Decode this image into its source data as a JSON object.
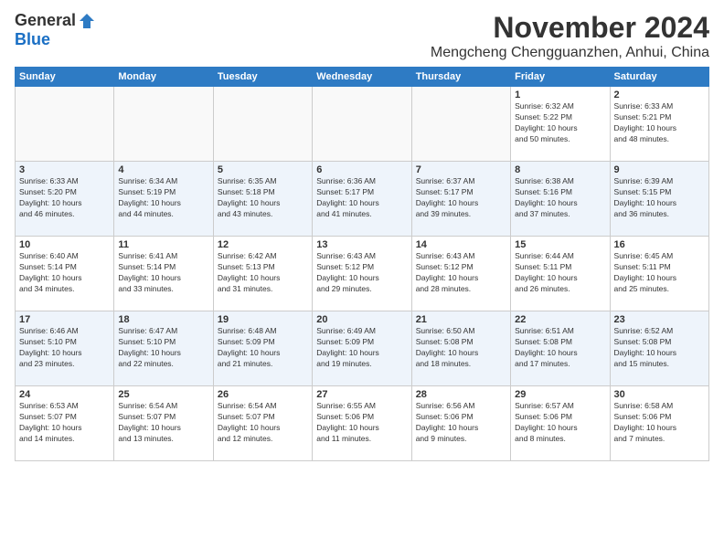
{
  "header": {
    "logo_general": "General",
    "logo_blue": "Blue",
    "month_title": "November 2024",
    "location": "Mengcheng Chengguanzhen, Anhui, China"
  },
  "weekdays": [
    "Sunday",
    "Monday",
    "Tuesday",
    "Wednesday",
    "Thursday",
    "Friday",
    "Saturday"
  ],
  "weeks": [
    [
      {
        "day": "",
        "info": ""
      },
      {
        "day": "",
        "info": ""
      },
      {
        "day": "",
        "info": ""
      },
      {
        "day": "",
        "info": ""
      },
      {
        "day": "",
        "info": ""
      },
      {
        "day": "1",
        "info": "Sunrise: 6:32 AM\nSunset: 5:22 PM\nDaylight: 10 hours\nand 50 minutes."
      },
      {
        "day": "2",
        "info": "Sunrise: 6:33 AM\nSunset: 5:21 PM\nDaylight: 10 hours\nand 48 minutes."
      }
    ],
    [
      {
        "day": "3",
        "info": "Sunrise: 6:33 AM\nSunset: 5:20 PM\nDaylight: 10 hours\nand 46 minutes."
      },
      {
        "day": "4",
        "info": "Sunrise: 6:34 AM\nSunset: 5:19 PM\nDaylight: 10 hours\nand 44 minutes."
      },
      {
        "day": "5",
        "info": "Sunrise: 6:35 AM\nSunset: 5:18 PM\nDaylight: 10 hours\nand 43 minutes."
      },
      {
        "day": "6",
        "info": "Sunrise: 6:36 AM\nSunset: 5:17 PM\nDaylight: 10 hours\nand 41 minutes."
      },
      {
        "day": "7",
        "info": "Sunrise: 6:37 AM\nSunset: 5:17 PM\nDaylight: 10 hours\nand 39 minutes."
      },
      {
        "day": "8",
        "info": "Sunrise: 6:38 AM\nSunset: 5:16 PM\nDaylight: 10 hours\nand 37 minutes."
      },
      {
        "day": "9",
        "info": "Sunrise: 6:39 AM\nSunset: 5:15 PM\nDaylight: 10 hours\nand 36 minutes."
      }
    ],
    [
      {
        "day": "10",
        "info": "Sunrise: 6:40 AM\nSunset: 5:14 PM\nDaylight: 10 hours\nand 34 minutes."
      },
      {
        "day": "11",
        "info": "Sunrise: 6:41 AM\nSunset: 5:14 PM\nDaylight: 10 hours\nand 33 minutes."
      },
      {
        "day": "12",
        "info": "Sunrise: 6:42 AM\nSunset: 5:13 PM\nDaylight: 10 hours\nand 31 minutes."
      },
      {
        "day": "13",
        "info": "Sunrise: 6:43 AM\nSunset: 5:12 PM\nDaylight: 10 hours\nand 29 minutes."
      },
      {
        "day": "14",
        "info": "Sunrise: 6:43 AM\nSunset: 5:12 PM\nDaylight: 10 hours\nand 28 minutes."
      },
      {
        "day": "15",
        "info": "Sunrise: 6:44 AM\nSunset: 5:11 PM\nDaylight: 10 hours\nand 26 minutes."
      },
      {
        "day": "16",
        "info": "Sunrise: 6:45 AM\nSunset: 5:11 PM\nDaylight: 10 hours\nand 25 minutes."
      }
    ],
    [
      {
        "day": "17",
        "info": "Sunrise: 6:46 AM\nSunset: 5:10 PM\nDaylight: 10 hours\nand 23 minutes."
      },
      {
        "day": "18",
        "info": "Sunrise: 6:47 AM\nSunset: 5:10 PM\nDaylight: 10 hours\nand 22 minutes."
      },
      {
        "day": "19",
        "info": "Sunrise: 6:48 AM\nSunset: 5:09 PM\nDaylight: 10 hours\nand 21 minutes."
      },
      {
        "day": "20",
        "info": "Sunrise: 6:49 AM\nSunset: 5:09 PM\nDaylight: 10 hours\nand 19 minutes."
      },
      {
        "day": "21",
        "info": "Sunrise: 6:50 AM\nSunset: 5:08 PM\nDaylight: 10 hours\nand 18 minutes."
      },
      {
        "day": "22",
        "info": "Sunrise: 6:51 AM\nSunset: 5:08 PM\nDaylight: 10 hours\nand 17 minutes."
      },
      {
        "day": "23",
        "info": "Sunrise: 6:52 AM\nSunset: 5:08 PM\nDaylight: 10 hours\nand 15 minutes."
      }
    ],
    [
      {
        "day": "24",
        "info": "Sunrise: 6:53 AM\nSunset: 5:07 PM\nDaylight: 10 hours\nand 14 minutes."
      },
      {
        "day": "25",
        "info": "Sunrise: 6:54 AM\nSunset: 5:07 PM\nDaylight: 10 hours\nand 13 minutes."
      },
      {
        "day": "26",
        "info": "Sunrise: 6:54 AM\nSunset: 5:07 PM\nDaylight: 10 hours\nand 12 minutes."
      },
      {
        "day": "27",
        "info": "Sunrise: 6:55 AM\nSunset: 5:06 PM\nDaylight: 10 hours\nand 11 minutes."
      },
      {
        "day": "28",
        "info": "Sunrise: 6:56 AM\nSunset: 5:06 PM\nDaylight: 10 hours\nand 9 minutes."
      },
      {
        "day": "29",
        "info": "Sunrise: 6:57 AM\nSunset: 5:06 PM\nDaylight: 10 hours\nand 8 minutes."
      },
      {
        "day": "30",
        "info": "Sunrise: 6:58 AM\nSunset: 5:06 PM\nDaylight: 10 hours\nand 7 minutes."
      }
    ]
  ]
}
